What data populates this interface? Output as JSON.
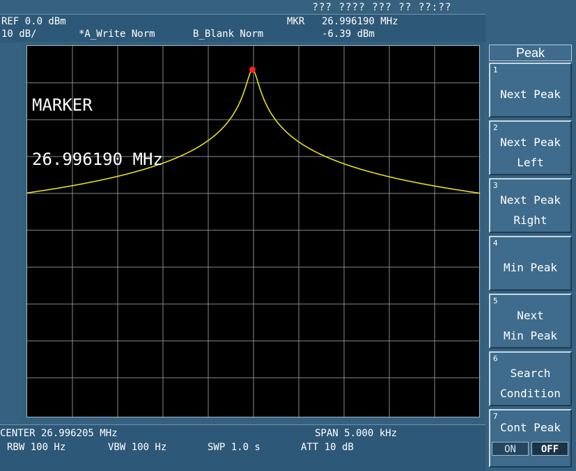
{
  "status": {
    "datetime": "??? ???? ??? ?? ??:??"
  },
  "header": {
    "ref_level": "REF 0.0 dBm",
    "scale": "10 dB/",
    "trace_a": "*A_Write Norm",
    "trace_b": "B_Blank Norm",
    "mkr_label": "MKR",
    "mkr_freq": "26.996190 MHz",
    "mkr_level": "-6.39 dBm"
  },
  "display": {
    "marker_title": "MARKER",
    "marker_freq": "26.996190 MHz",
    "trace_color": "#e8e020",
    "marker_color": "#ff2020"
  },
  "footer": {
    "center": "CENTER 26.996205 MHz",
    "span": "SPAN 5.000 kHz",
    "rbw": "RBW 100 Hz",
    "vbw": "VBW 100 Hz",
    "swp": "SWP 1.0 s",
    "att": "ATT 10 dB"
  },
  "softkeys": {
    "title": "Peak",
    "keys": [
      {
        "num": "1",
        "line1": "Next Peak",
        "line2": ""
      },
      {
        "num": "2",
        "line1": "Next Peak",
        "line2": "Left"
      },
      {
        "num": "3",
        "line1": "Next Peak",
        "line2": "Right"
      },
      {
        "num": "4",
        "line1": "Min Peak",
        "line2": ""
      },
      {
        "num": "5",
        "line1": "Next",
        "line2": "Min Peak"
      },
      {
        "num": "6",
        "line1": "Search",
        "line2": "Condition"
      },
      {
        "num": "7",
        "line1": "Cont Peak",
        "line2": ""
      }
    ],
    "toggle_on": "ON",
    "toggle_off": "OFF"
  },
  "chart_data": {
    "type": "line",
    "center_mhz": 26.996205,
    "span_khz": 5.0,
    "ref_level_dbm": 0.0,
    "scale_db_per_div": 10,
    "peak_freq_mhz": 26.99619,
    "peak_level_dbm": -6.39
  }
}
